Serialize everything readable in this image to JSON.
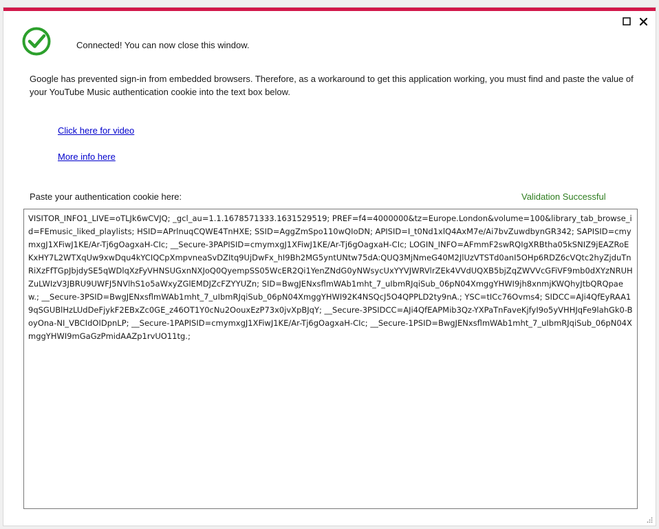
{
  "window": {
    "accent_color": "#d2184a",
    "controls": {
      "maximize_icon": "maximize-icon",
      "close_icon": "close-icon"
    }
  },
  "status": {
    "icon": "check-circle-icon",
    "icon_color": "#2ca02c",
    "message": "Connected! You can now close this window."
  },
  "description": "Google has prevented sign-in from embedded browsers. Therefore, as a workaround to get this application working, you must find and paste the value of your YouTube Music authentication cookie into the text box below.",
  "links": {
    "video": "Click here for video",
    "more_info": "More info here"
  },
  "cookie_section": {
    "label": "Paste your authentication cookie here:",
    "validation_text": "Validation Successful",
    "validation_color": "#2e7d1f",
    "cookie_value": "VISITOR_INFO1_LIVE=oTLJk6wCVJQ; _gcl_au=1.1.1678571333.1631529519; PREF=f4=4000000&tz=Europe.London&volume=100&library_tab_browse_id=FEmusic_liked_playlists; HSID=APrlnuqCQWE4TnHXE; SSID=AggZmSpo110wQIoDN; APISID=I_t0Nd1xlQ4AxM7e/Ai7bvZuwdbynGR342; SAPISID=cmymxgJ1XFiwJ1KE/Ar-Tj6gOagxaH-CIc; __Secure-3PAPISID=cmymxgJ1XFiwJ1KE/Ar-Tj6gOagxaH-CIc; LOGIN_INFO=AFmmF2swRQIgXRBtha05kSNIZ9jEAZRoEKxHY7L2WTXqUw9xwDqu4kYCIQCpXmpvneaSvDZItq9UjDwFx_hI9Bh2MG5yntUNtw75dA:QUQ3MjNmeG40M2JlUzVTSTd0anI5OHp6RDZ6cVQtc2hyZjduTnRiXzFfTGpJbjdySE5qWDlqXzFyVHNSUGxnNXJoQ0QyempSS05WcER2Qi1YenZNdG0yNWsycUxYYVJWRVlrZEk4VVdUQXB5bjZqZWVVcGFiVF9mb0dXYzNRUHZuLWIzV3JBRU9UWFJ5NVlhS1o5aWxyZGlEMDJZcFZYYUZn; SID=BwgJENxsflmWAb1mht_7_uIbmRJqiSub_06pN04XmggYHWI9jh8xnmjKWQhyJtbQRQpaew.; __Secure-3PSID=BwgJENxsflmWAb1mht_7_uIbmRJqiSub_06pN04XmggYHWI92K4NSQcJ5O4QPPLD2ty9nA.; YSC=tICc76Ovms4; SIDCC=AJi4QfEyRAA19qSGUBlHzLUdDeFjykF2EBxZc0GE_z46OT1Y0cNu2OouxEzP73x0jvXpBJqY; __Secure-3PSIDCC=AJi4QfEAPMib3Qz-YXPaTnFaveKjfyI9o5yVHHJqFe9lahGk0-BoyOna-NI_VBCIdOIDpnLP; __Secure-1PAPISID=cmymxgJ1XFiwJ1KE/Ar-Tj6gOagxaH-CIc; __Secure-1PSID=BwgJENxsflmWAb1mht_7_uIbmRJqiSub_06pN04XmggYHWI9mGaGzPmidAAZp1rvUO11tg.;"
  }
}
